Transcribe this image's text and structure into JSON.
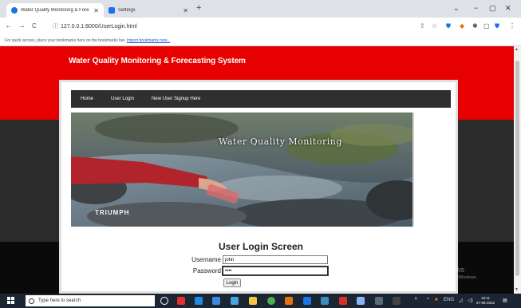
{
  "browser": {
    "tabs": [
      {
        "title": "Water Quality Monitoring & Fore",
        "active": true
      },
      {
        "title": "Settings",
        "active": false
      }
    ],
    "new_tab": "+",
    "window_controls": {
      "minimize": "−",
      "maximize": "▢",
      "close": "✕",
      "dropdown": "⌄"
    },
    "nav": {
      "back": "←",
      "forward": "→",
      "reload": "C"
    },
    "url": "127.0.0.1:8000/UserLogin.html",
    "bookmarks_bar": {
      "text": "For quick access, place your bookmarks here on the bookmarks bar.",
      "link": "Import bookmarks now..."
    }
  },
  "page": {
    "site_title": "Water Quality Monitoring & Forecasting System",
    "menu": [
      "Home",
      "User Login",
      "New User Signup Here"
    ],
    "hero": {
      "caption": "Water Quality Monitoring",
      "logo": "TRIUMPH"
    },
    "login": {
      "title": "User Login Screen",
      "username_label": "Username",
      "username_value": "john",
      "password_label": "Password",
      "password_value": "••••",
      "button": "Login"
    },
    "watermark": {
      "line1": "Activate Windows",
      "line2": "Go to Settings to activate Windows."
    }
  },
  "taskbar": {
    "search_placeholder": "Type here to search",
    "time": "16:11",
    "date": "27-06-2022",
    "lang": "ENG"
  },
  "colors": {
    "brand_red": "#e60000",
    "menu_bg": "#2f2f2f",
    "taskbar": "#1c2633"
  }
}
